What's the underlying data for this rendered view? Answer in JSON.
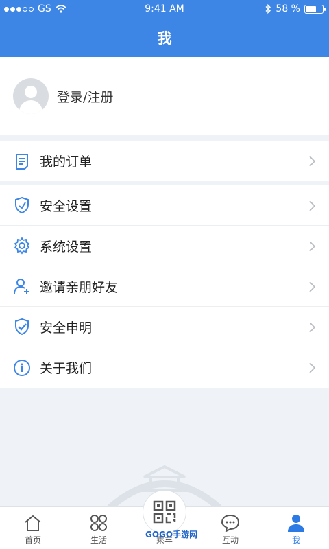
{
  "status": {
    "carrier": "GS",
    "time": "9:41 AM",
    "battery": "58 %",
    "battery_level": 0.58
  },
  "header": {
    "title": "我"
  },
  "profile": {
    "login_label": "登录/注册"
  },
  "menu_group1": [
    {
      "label": "我的订单",
      "icon": "order-list-icon"
    }
  ],
  "menu_group2": [
    {
      "label": "安全设置",
      "icon": "shield-icon"
    },
    {
      "label": "系统设置",
      "icon": "gear-icon"
    },
    {
      "label": "邀请亲朋好友",
      "icon": "add-user-icon"
    },
    {
      "label": "安全申明",
      "icon": "shield-check-icon"
    },
    {
      "label": "关于我们",
      "icon": "info-icon"
    }
  ],
  "tabs": [
    {
      "label": "首页",
      "icon": "home-icon"
    },
    {
      "label": "生活",
      "icon": "grid-icon"
    },
    {
      "label": "乘车",
      "icon": "qr-code-icon"
    },
    {
      "label": "互动",
      "icon": "chat-icon"
    },
    {
      "label": "我",
      "icon": "user-icon",
      "active": true
    }
  ],
  "watermark": "GOGO手游网",
  "colors": {
    "accent": "#3d86e6",
    "active_tab": "#2c7be5"
  }
}
